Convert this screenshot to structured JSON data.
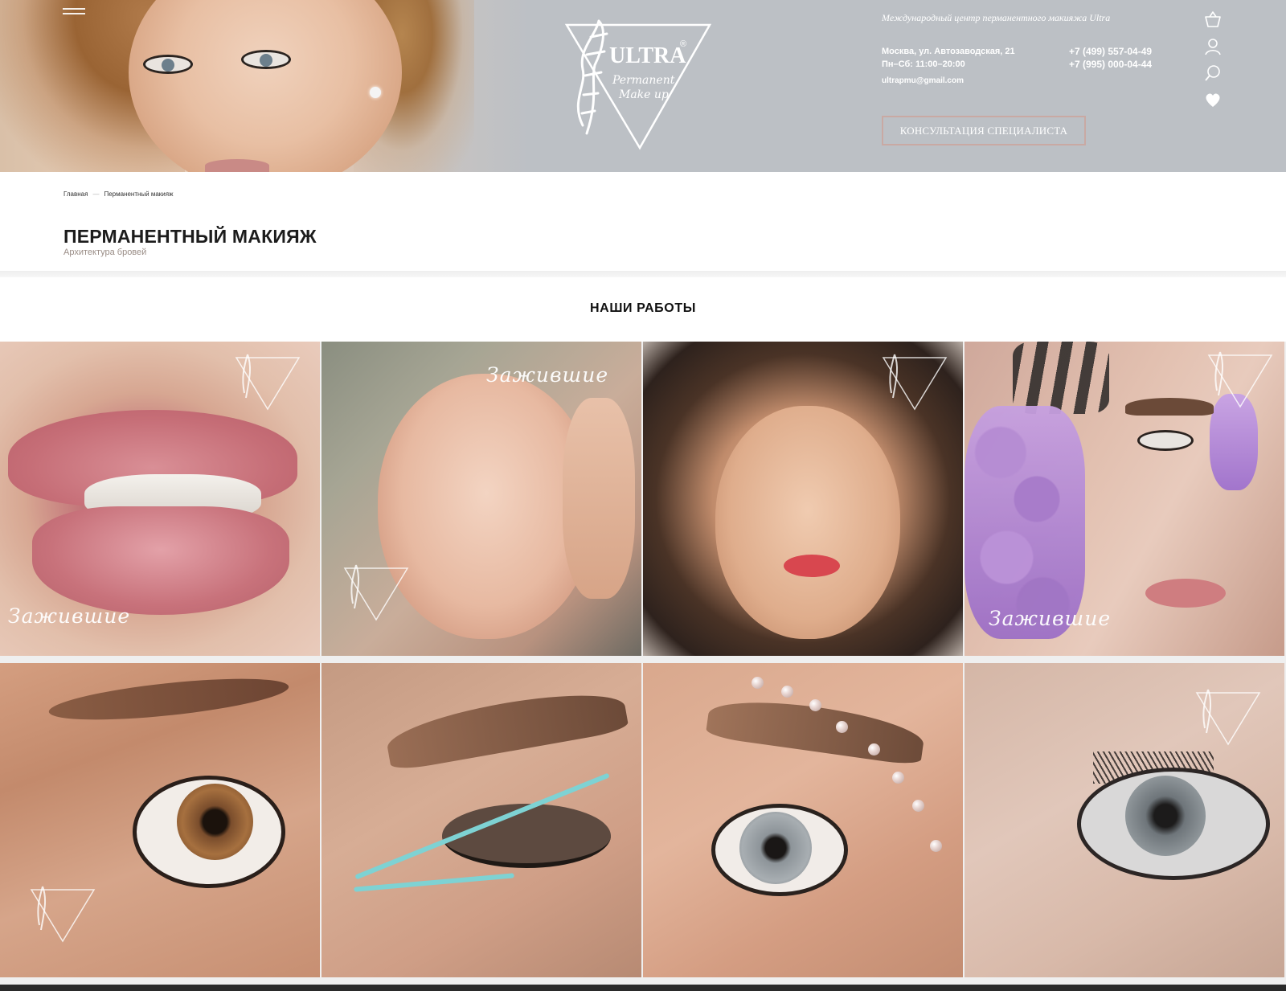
{
  "header": {
    "tagline": "Международный центр перманентного макияжа Ultra",
    "address_line1": "Москва, ул. Автозаводская, 21",
    "address_line2": "Пн–Сб: 11:00–20:00",
    "email": "ultrapmu@gmail.com",
    "phone1": "+7 (499) 557-04-49",
    "phone2": "+7 (995) 000-04-44",
    "consult_button": "КОНСУЛЬТАЦИЯ СПЕЦИАЛИСТА",
    "logo": {
      "name": "ULTRA",
      "registered": "®",
      "sub1": "Permanent",
      "sub2": "Make up"
    },
    "icons": [
      "cart-icon",
      "user-icon",
      "search-icon",
      "heart-icon"
    ]
  },
  "breadcrumb": {
    "home": "Главная",
    "separator": "—",
    "current": "Перманентный макияж"
  },
  "page": {
    "title": "ПЕРМАНЕНТНЫЙ МАКИЯЖ",
    "subtitle": "Архитектура бровей"
  },
  "works": {
    "title": "НАШИ РАБОТЫ",
    "script_label": "Зажившие"
  },
  "colors": {
    "header_bg": "#bcc0c5",
    "button_border": "#c9a9a3",
    "accent_liner": "#7ed2d3"
  }
}
